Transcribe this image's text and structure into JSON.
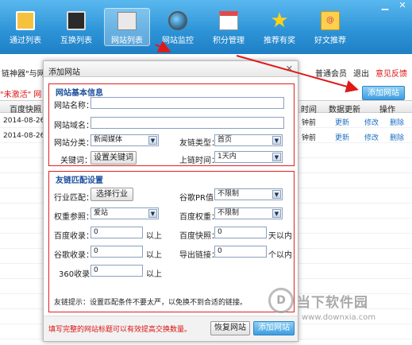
{
  "nav": [
    {
      "label": "通过列表",
      "icon": "clipboard-icon"
    },
    {
      "label": "互换列表",
      "icon": "monitor-icon"
    },
    {
      "label": "网站列表",
      "icon": "site-list-icon"
    },
    {
      "label": "网站监控",
      "icon": "globe-icon"
    },
    {
      "label": "积分管理",
      "icon": "calendar-icon"
    },
    {
      "label": "推荐有奖",
      "icon": "star-icon"
    },
    {
      "label": "好文推荐",
      "icon": "mail-icon"
    }
  ],
  "window": {
    "minimize": "▁",
    "close": "✕"
  },
  "subbar": {
    "left": "链神器\"与网",
    "member": "普通会员",
    "logout": "退出",
    "feedback": "意见反馈"
  },
  "warn_line": "\"未激活\" 网",
  "add_site_button": "添加网站",
  "table": {
    "headers": {
      "snap": "百度快照",
      "time": "时间",
      "update": "数据更新",
      "ops": "操作"
    },
    "rows": [
      {
        "date": "2014-08-26",
        "time": "钟前",
        "update": "更新",
        "edit": "修改",
        "delete": "删除"
      },
      {
        "date": "2014-08-26",
        "time": "钟前",
        "update": "更新",
        "edit": "修改",
        "delete": "删除"
      }
    ]
  },
  "dialog": {
    "title": "添加网站",
    "close": "✕",
    "basic": {
      "title": "网站基本信息",
      "name_label": "网站名称：",
      "name_value": "",
      "domain_label": "网站域名：",
      "domain_value": "",
      "category_label": "网站分类：",
      "category_value": "新闻媒体",
      "link_type_label": "友链类型：",
      "link_type_value": "首页",
      "keyword_label": "关键词：",
      "keyword_button": "设置关键词",
      "link_time_label": "上链时间：",
      "link_time_value": "1天内"
    },
    "match": {
      "title": "友链匹配设置",
      "industry_label": "行业匹配：",
      "industry_button": "选择行业",
      "pr_label": "谷歌PR值：",
      "pr_value": "不限制",
      "weight_ref_label": "权重参照：",
      "weight_ref_value": "爱站",
      "baidu_weight_label": "百度权重：",
      "baidu_weight_value": "不限制",
      "baidu_index_label": "百度收录：",
      "baidu_index_value": "0",
      "baidu_index_unit": "以上",
      "snapshot_label": "百度快照：",
      "snapshot_value": "0",
      "snapshot_unit": "天以内",
      "google_index_label": "谷歌收录：",
      "google_index_value": "0",
      "google_index_unit": "以上",
      "outlinks_label": "导出链接：",
      "outlinks_value": "0",
      "outlinks_unit": "个以内",
      "s360_label": "360收录：",
      "s360_value": "0",
      "s360_unit": "以上",
      "tip": "友链提示：设置匹配条件不要太严，以免换不到合适的链接。"
    },
    "footer": {
      "warn": "填写完整的网站标题可以有效提高交换数量。",
      "restore": "恢复网站",
      "add": "添加网站"
    }
  },
  "watermark": {
    "logo": "D",
    "name": "当下软件园",
    "url": "www.downxia.com"
  },
  "accent_colors": {
    "toolbar": "#2c92d6",
    "warning": "#d11111",
    "group_border": "#e02020"
  }
}
